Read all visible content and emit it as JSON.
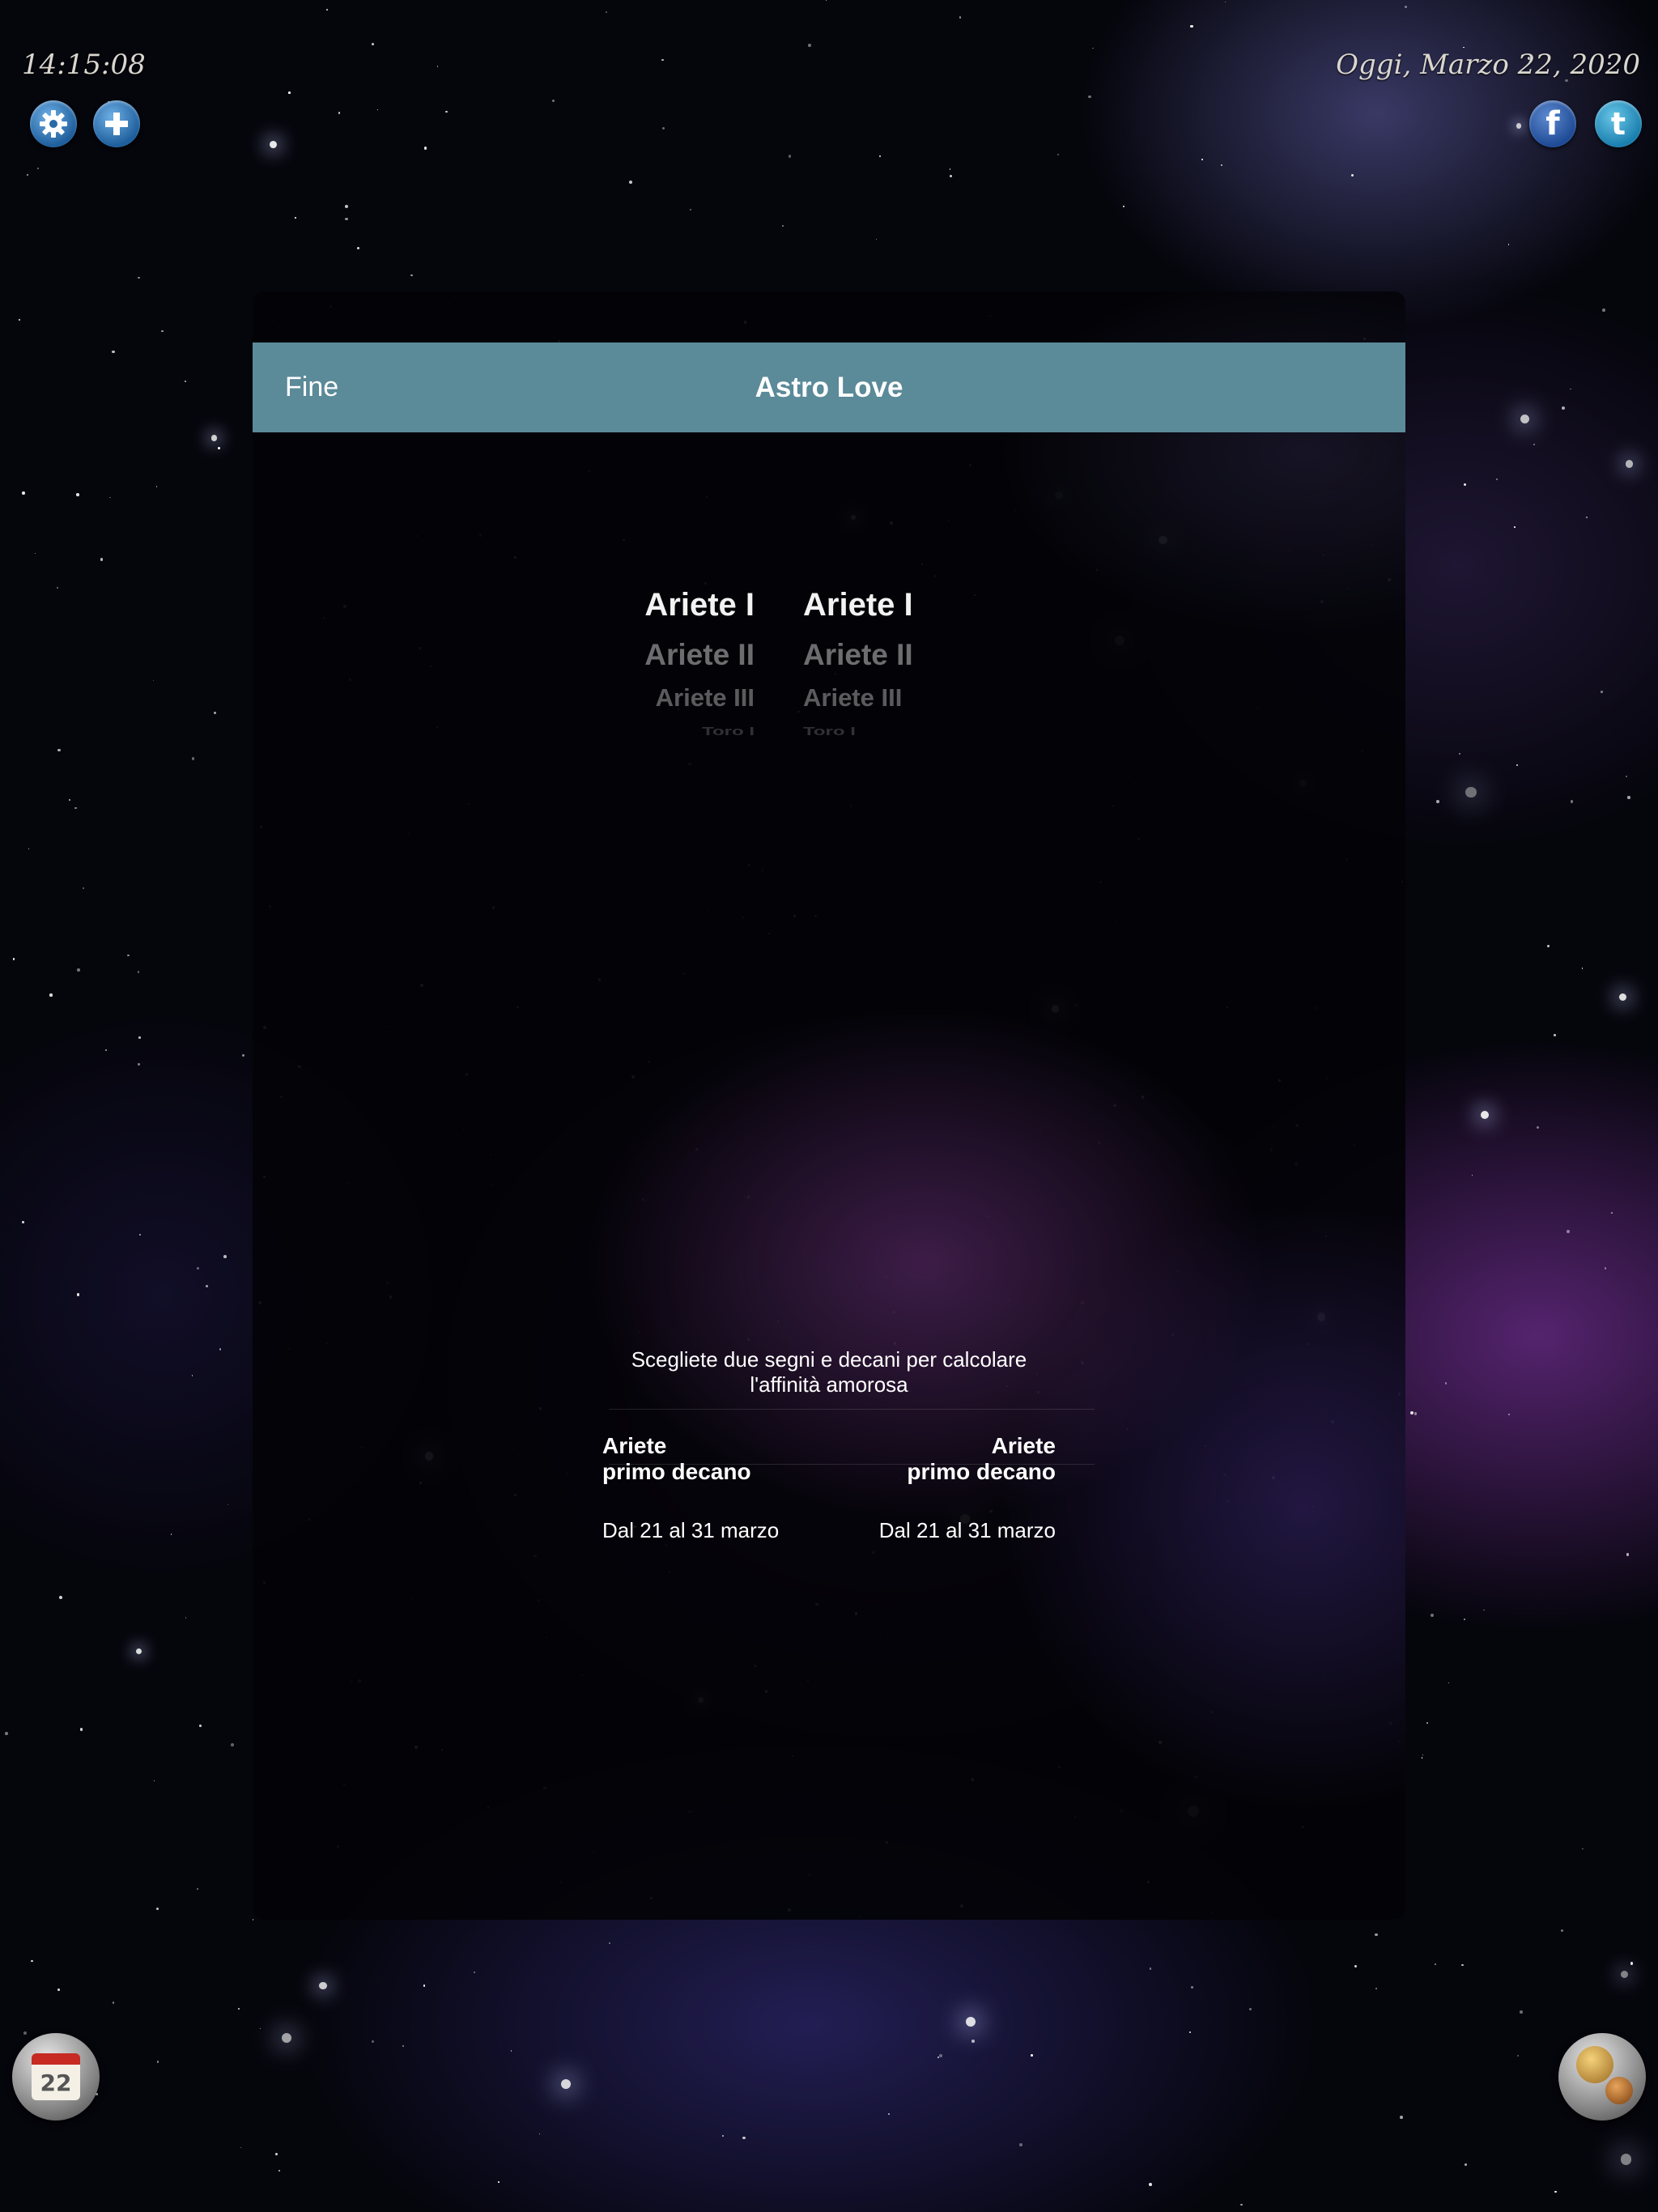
{
  "status": {
    "time": "14:15:08",
    "date": "Oggi, Marzo 22, 2020"
  },
  "icons": {
    "settings": "gear-icon",
    "add": "plus-icon",
    "facebook": "facebook-icon",
    "twitter": "twitter-icon",
    "calendar": "calendar-icon",
    "calendar_day": "22",
    "planets": "planets-icon"
  },
  "modal": {
    "done_label": "Fine",
    "title": "Astro Love",
    "nav_color": "#5b8a99"
  },
  "picker": {
    "left": [
      "Ariete I",
      "Ariete II",
      "Ariete III",
      "Toro I"
    ],
    "right": [
      "Ariete I",
      "Ariete II",
      "Ariete III",
      "Toro I"
    ],
    "selected_left": "Ariete I",
    "selected_right": "Ariete I"
  },
  "instructions": {
    "line1": "Scegliete due segni e decani per calcolare",
    "line2": "l'affinità amorosa"
  },
  "result_left": {
    "sign": "Ariete",
    "decan": "primo decano",
    "dates": "Dal 21 al 31 marzo"
  },
  "result_right": {
    "sign": "Ariete",
    "decan": "primo decano",
    "dates": "Dal 21 al 31 marzo"
  }
}
